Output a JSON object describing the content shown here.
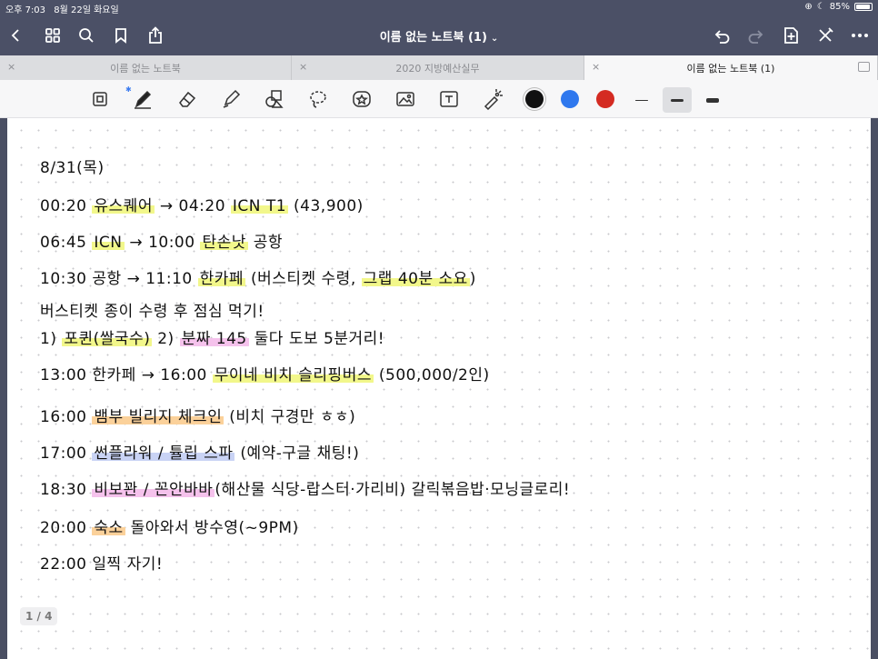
{
  "status": {
    "time": "오후 7:03",
    "date": "8월 22일 화요일",
    "battery": "85%",
    "battery_level": 0.85
  },
  "header": {
    "title": "이름 없는 노트북 (1)"
  },
  "tabs": [
    {
      "label": "이름 없는 노트북",
      "active": false
    },
    {
      "label": "2020 지방예산실무",
      "active": false
    },
    {
      "label": "이름 없는 노트북 (1)",
      "active": true
    }
  ],
  "colors": {
    "black": "#111111",
    "blue": "#2f78ee",
    "red": "#d42b22",
    "accent_bar": "#4b5066"
  },
  "icons": [
    "back-icon",
    "grid-icon",
    "search-icon",
    "bookmark-icon",
    "share-icon",
    "undo-icon",
    "redo-icon",
    "add-page-icon",
    "close-toolbar-icon",
    "more-icon"
  ],
  "page": {
    "indicator": "1 / 4"
  },
  "notes": [
    {
      "segments": [
        {
          "text": "8/31(목)",
          "hl": ""
        }
      ]
    },
    {
      "segments": [
        {
          "text": "00:20 ",
          "hl": ""
        },
        {
          "text": "유스퀘어",
          "hl": "yellow"
        },
        {
          "text": " → 04:20 ",
          "hl": ""
        },
        {
          "text": "ICN T1",
          "hl": "yellow"
        },
        {
          "text": " (43,900)",
          "hl": ""
        }
      ]
    },
    {
      "segments": [
        {
          "text": "06:45 ",
          "hl": ""
        },
        {
          "text": "ICN",
          "hl": "yellow"
        },
        {
          "text": " → 10:00 ",
          "hl": ""
        },
        {
          "text": "탄손낫",
          "hl": "yellow"
        },
        {
          "text": " 공항",
          "hl": ""
        }
      ]
    },
    {
      "segments": [
        {
          "text": "10:30 공항 → 11:10 ",
          "hl": ""
        },
        {
          "text": "한카페",
          "hl": "yellow"
        },
        {
          "text": " (버스티켓 수령, ",
          "hl": ""
        },
        {
          "text": "그랩 40분 소요",
          "hl": "yellow"
        },
        {
          "text": ")",
          "hl": ""
        }
      ]
    },
    {
      "segments": [
        {
          "text": "버스티켓 종이 수령 후 점심 먹기!",
          "hl": ""
        }
      ]
    },
    {
      "segments": [
        {
          "text": " 1) ",
          "hl": ""
        },
        {
          "text": "포퀸(쌀국수)",
          "hl": "yellow"
        },
        {
          "text": "   2) ",
          "hl": ""
        },
        {
          "text": "분짜 145",
          "hl": "pink"
        },
        {
          "text": "   둘다 도보 5분거리!",
          "hl": ""
        }
      ]
    },
    {
      "segments": [
        {
          "text": "13:00  한카페 → 16:00 ",
          "hl": ""
        },
        {
          "text": "무이네 비치 슬리핑버스",
          "hl": "yellow"
        },
        {
          "text": " (500,000/2인)",
          "hl": ""
        }
      ]
    },
    {
      "segments": [
        {
          "text": "16:00 ",
          "hl": ""
        },
        {
          "text": "뱀부 빌리지 체크인",
          "hl": "orange"
        },
        {
          "text": " (비치 구경만 ㅎㅎ)",
          "hl": ""
        }
      ]
    },
    {
      "segments": [
        {
          "text": "17:00 ",
          "hl": ""
        },
        {
          "text": "썬플라워 / 튤립 스파",
          "hl": "blue"
        },
        {
          "text": " (예약-구글 채팅!)",
          "hl": ""
        }
      ]
    },
    {
      "segments": [
        {
          "text": "18:30 ",
          "hl": ""
        },
        {
          "text": "비보꽌 / 꼰안바바",
          "hl": "pink"
        },
        {
          "text": "(해산물 식당-랍스터·가리비) 갈릭볶음밥·모닝글로리!",
          "hl": ""
        }
      ]
    },
    {
      "segments": [
        {
          "text": "20:00 ",
          "hl": ""
        },
        {
          "text": "숙소",
          "hl": "orange"
        },
        {
          "text": " 돌아와서 방수영(~9PM)",
          "hl": ""
        }
      ]
    },
    {
      "segments": [
        {
          "text": "22:00 일찍 자기!",
          "hl": ""
        }
      ]
    }
  ]
}
